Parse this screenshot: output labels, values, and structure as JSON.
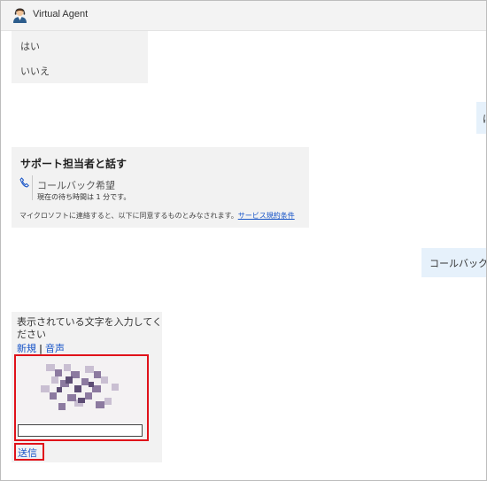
{
  "header": {
    "title": "Virtual Agent",
    "avatar_icon": "agent-avatar-icon"
  },
  "chat": {
    "options": [
      "はい",
      "いいえ"
    ],
    "user_reply_1": "は",
    "card": {
      "title": "サポート担当者と話す",
      "icon": "phone-icon",
      "callback_label": "コールバック希望",
      "wait_time": "現在の待ち時間は 1 分です。",
      "consent_text": "マイクロソフトに連絡すると、以下に同意するものとみなされます。",
      "terms_link": "サービス規約条件"
    },
    "user_reply_2": "コールバック希望",
    "captcha": {
      "prompt": "表示されている文字を入力してください",
      "new_link": "新規",
      "separator": "|",
      "audio_link": "音声",
      "input_value": "",
      "submit_label": "送信"
    }
  },
  "colors": {
    "header_bg": "#f3f3f3",
    "agent_bubble": "#f2f2f2",
    "user_bubble": "#e6f1fb",
    "link": "#1a56c8",
    "highlight": "#e0121a"
  }
}
